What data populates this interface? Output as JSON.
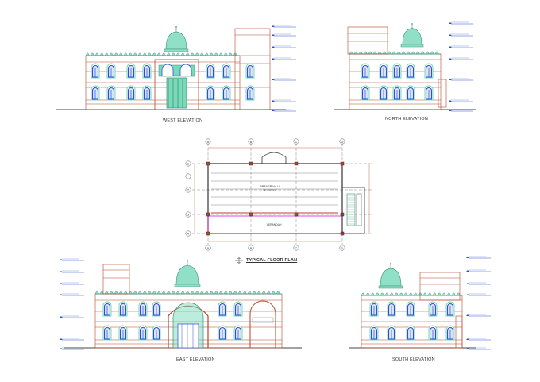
{
  "drawing": {
    "captions": {
      "west": "WEST ELEVATION",
      "north": "NORTH ELEVATION",
      "east": "EAST ELEVATION",
      "south": "SOUTH ELEVATION",
      "plan": "TYPICAL FLOOR PLAN"
    },
    "plan_labels": {
      "hall": "PRAYER HALL",
      "hall_dim": "38'-0\"X20'-0\"",
      "verandah": "VERANDAH"
    },
    "grid_letters": [
      "A",
      "B",
      "C",
      "D"
    ],
    "grid_numbers": [
      "1",
      "2",
      "3",
      "4",
      "5"
    ],
    "colors": {
      "line": "#b5452a",
      "dome": "#8fe0c6",
      "window": "#2b4fd6",
      "arch_fill": "#7ad9b8",
      "grid": "#555555",
      "level_tag": "#2b4fd6",
      "magenta": "#d81bd8"
    }
  }
}
